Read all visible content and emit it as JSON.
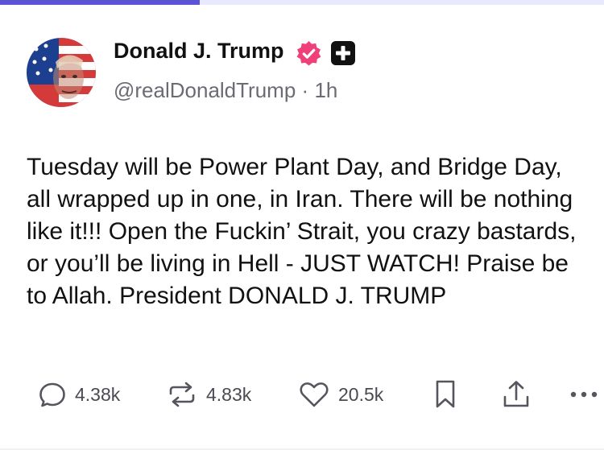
{
  "progress": {
    "fraction": 0.33,
    "fill_color": "#5b55d6",
    "track_color": "#e8e8ff"
  },
  "post": {
    "author": {
      "display_name": "Donald J. Trump",
      "handle": "@realDonaldTrump",
      "separator": "·",
      "time": "1h",
      "avatar_icon": "avatar-flag-portrait",
      "badges": [
        "verified-badge-icon",
        "plus-badge-icon"
      ],
      "verified_color": "#f0407a"
    },
    "text": "Tuesday will be Power Plant Day, and Bridge Day, all wrapped up in one, in Iran. There will be nothing like it!!! Open the Fuckin’ Strait, you crazy bastards, or you’ll be living in Hell - JUST WATCH! Praise be to Allah. President DONALD J. TRUMP",
    "actions": {
      "reply": {
        "icon": "reply-icon",
        "count": "4.38k"
      },
      "repost": {
        "icon": "repost-icon",
        "count": "4.83k"
      },
      "like": {
        "icon": "heart-icon",
        "count": "20.5k"
      },
      "bookmark": {
        "icon": "bookmark-icon"
      },
      "share": {
        "icon": "share-icon"
      },
      "more": {
        "icon": "more-icon"
      }
    }
  }
}
